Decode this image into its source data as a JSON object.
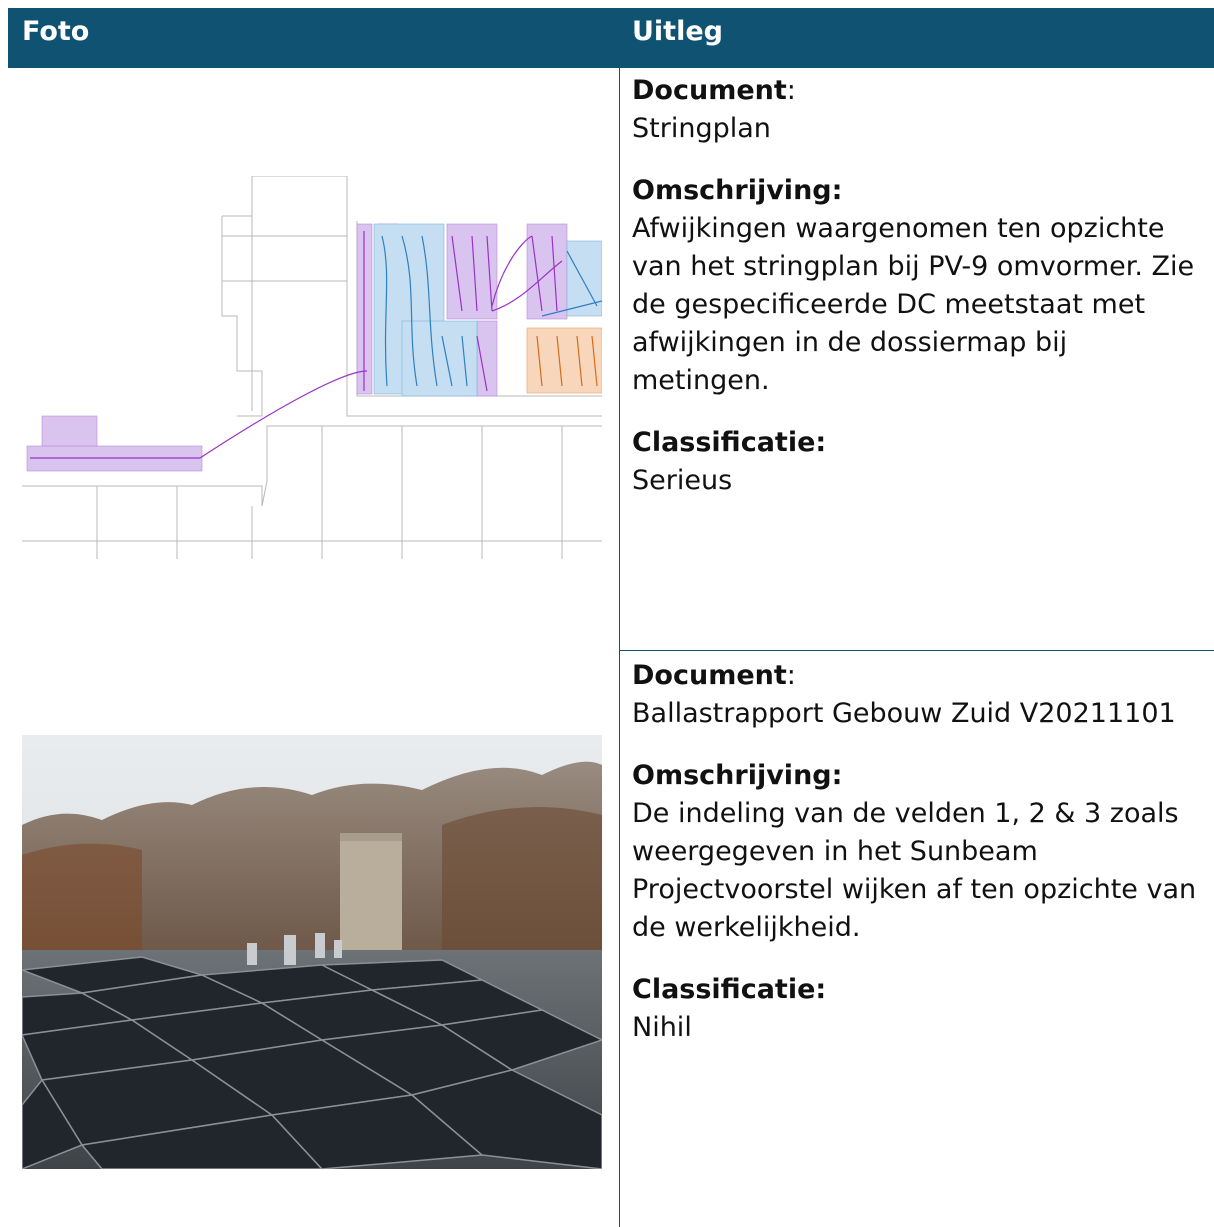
{
  "header": {
    "col_photo": "Foto",
    "col_explain": "Uitleg"
  },
  "rows": [
    {
      "document_label": "Document",
      "document_value": "Stringplan",
      "description_label": "Omschrijving:",
      "description_value": "Afwijkingen waargenomen ten opzichte van het stringplan bij PV-9 omvormer. Zie de gespecificeerde DC meetstaat met afwijkingen in de dossiermap bij metingen.",
      "classification_label": "Classificatie:",
      "classification_value": "Serieus"
    },
    {
      "document_label": "Document",
      "document_value": "Ballastrapport Gebouw Zuid V20211101",
      "description_label": "Omschrijving:",
      "description_value": "De indeling van de velden 1, 2 & 3 zoals weergegeven in het Sunbeam Projectvoorstel wijken af ten opzichte van de werkelijkheid.",
      "classification_label": "Classificatie:",
      "classification_value": "Nihil"
    }
  ],
  "colors": {
    "header_bg": "#0f5272",
    "magenta": "#a23fcf",
    "blue": "#3d8fd1",
    "orange": "#e07a28"
  }
}
